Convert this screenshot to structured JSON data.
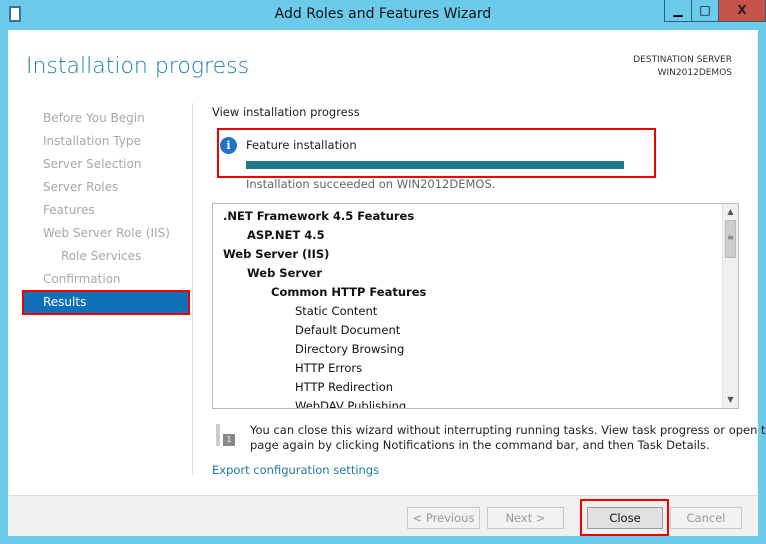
{
  "window": {
    "title": "Add Roles and Features Wizard",
    "minimize": "▁",
    "maximize": "□",
    "close": "X"
  },
  "header": {
    "title": "Installation progress",
    "destination_label": "DESTINATION SERVER",
    "destination_server": "WIN2012DEMOS"
  },
  "nav": {
    "items": [
      "Before You Begin",
      "Installation Type",
      "Server Selection",
      "Server Roles",
      "Features",
      "Web Server Role (IIS)",
      "Role Services",
      "Confirmation",
      "Results"
    ],
    "active": "Results"
  },
  "main": {
    "section_label": "View installation progress",
    "progress_title": "Feature installation",
    "progress_percent": 100,
    "progress_color": "#1d7a8c",
    "status": "Installation succeeded on WIN2012DEMOS.",
    "items": [
      {
        "text": ".NET Framework 4.5 Features",
        "level": 0
      },
      {
        "text": "ASP.NET 4.5",
        "level": 1
      },
      {
        "text": "Web Server (IIS)",
        "level": 0
      },
      {
        "text": "Web Server",
        "level": 1
      },
      {
        "text": "Common HTTP Features",
        "level": 2
      },
      {
        "text": "Static Content",
        "level": 3
      },
      {
        "text": "Default Document",
        "level": 3
      },
      {
        "text": "Directory Browsing",
        "level": 3
      },
      {
        "text": "HTTP Errors",
        "level": 3
      },
      {
        "text": "HTTP Redirection",
        "level": 3
      },
      {
        "text": "WebDAV Publishing",
        "level": 3
      }
    ],
    "note_line1": "You can close this wizard without interrupting running tasks. View task progress or open this",
    "note_line2": "page again by clicking Notifications in the command bar, and then Task Details.",
    "notification_badge": "1",
    "export_link": "Export configuration settings"
  },
  "footer": {
    "previous": "< Previous",
    "next": "Next >",
    "close": "Close",
    "cancel": "Cancel"
  }
}
